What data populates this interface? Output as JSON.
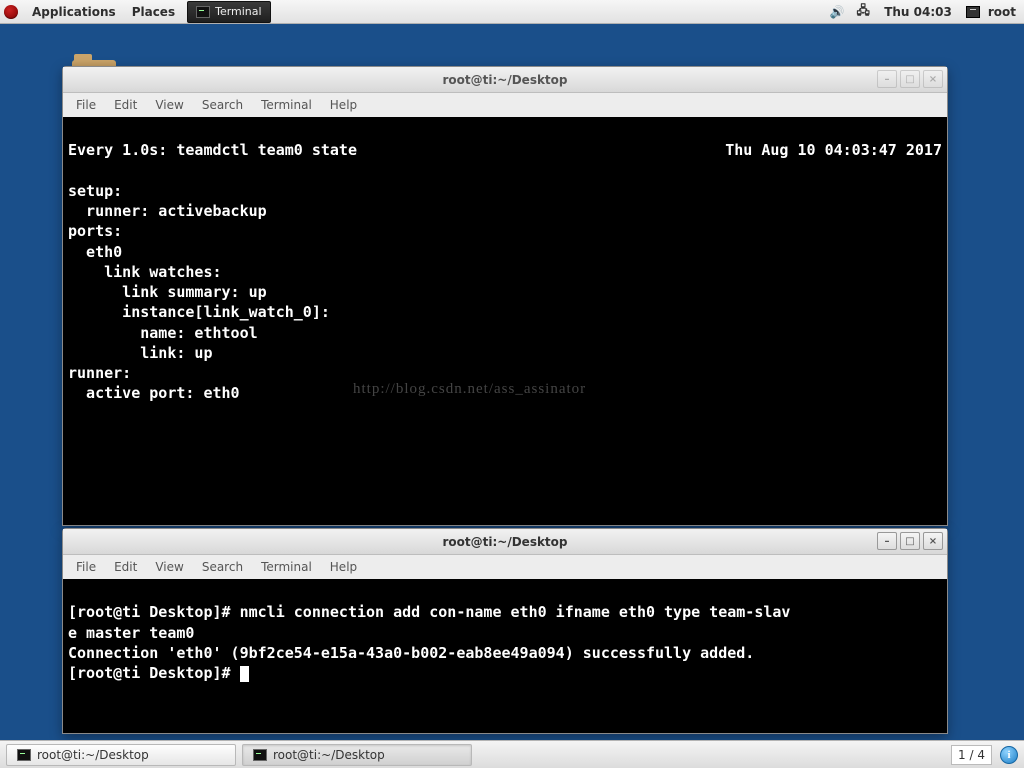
{
  "top_panel": {
    "applications": "Applications",
    "places": "Places",
    "running_app": "Terminal",
    "clock": "Thu 04:03",
    "user": "root"
  },
  "window1": {
    "title": "root@ti:~/Desktop",
    "menu": {
      "file": "File",
      "edit": "Edit",
      "view": "View",
      "search": "Search",
      "terminal": "Terminal",
      "help": "Help"
    },
    "watch_left": "Every 1.0s: teamdctl team0 state",
    "watch_right": "Thu Aug 10 04:03:47 2017",
    "body_lines": [
      "",
      "setup:",
      "  runner: activebackup",
      "ports:",
      "  eth0",
      "    link watches:",
      "      link summary: up",
      "      instance[link_watch_0]:",
      "        name: ethtool",
      "        link: up",
      "runner:",
      "  active port: eth0"
    ],
    "watermark": "http://blog.csdn.net/ass_assinator"
  },
  "window2": {
    "title": "root@ti:~/Desktop",
    "menu": {
      "file": "File",
      "edit": "Edit",
      "view": "View",
      "search": "Search",
      "terminal": "Terminal",
      "help": "Help"
    },
    "lines": [
      "[root@ti Desktop]# nmcli connection add con-name eth0 ifname eth0 type team-slav",
      "e master team0",
      "Connection 'eth0' (9bf2ce54-e15a-43a0-b002-eab8ee49a094) successfully added.",
      "[root@ti Desktop]# "
    ]
  },
  "bottom_panel": {
    "task1": "root@ti:~/Desktop",
    "task2": "root@ti:~/Desktop",
    "workspace": "1 / 4"
  },
  "win_controls": {
    "min": "–",
    "max": "□",
    "close": "×"
  }
}
